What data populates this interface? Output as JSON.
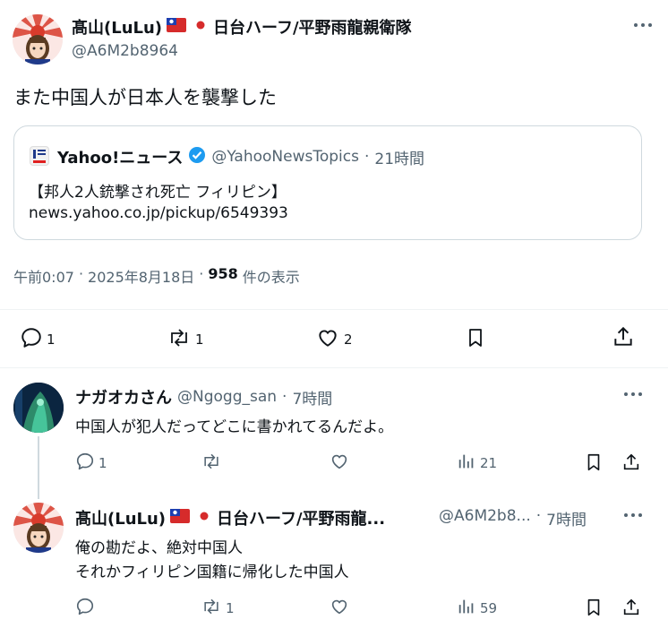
{
  "main_post": {
    "display_name": "髙山(LuLu)",
    "name_suffix": "日台ハーフ/平野雨龍親衛隊",
    "handle": "@A6M2b8964",
    "text": "また中国人が日本人を襲撃した",
    "quote": {
      "source_name": "Yahoo!ニュース",
      "handle": "@YahooNewsTopics",
      "separator": "·",
      "time": "21時間",
      "headline": "【邦人2人銃撃され死亡 フィリピン】",
      "link": "news.yahoo.co.jp/pickup/6549393"
    },
    "meta": {
      "time": "午前0:07",
      "sep1": "·",
      "date": "2025年8月18日",
      "sep2": "·",
      "views_count": "958",
      "views_label": "件の表示"
    },
    "actions": {
      "replies": "1",
      "reposts": "1",
      "likes": "2"
    }
  },
  "replies": [
    {
      "display_name": "ナガオカさん",
      "handle": "@Ngogg_san",
      "separator": "·",
      "time": "7時間",
      "lines": [
        "中国人が犯人だってどこに書かれてるんだよ。"
      ],
      "actions": {
        "replies": "1",
        "reposts": "",
        "likes": "",
        "views": "21"
      }
    },
    {
      "display_name": "髙山(LuLu)",
      "name_suffix": "日台ハーフ/平野雨龍...",
      "handle": "@A6M2b8...",
      "separator": "·",
      "time": "7時間",
      "lines": [
        "俺の勘だよ、絶対中国人",
        "それかフィリピン国籍に帰化した中国人"
      ],
      "actions": {
        "replies": "",
        "reposts": "1",
        "likes": "",
        "views": "59"
      }
    }
  ],
  "colors": {
    "text": "#0f1419",
    "muted": "#536471",
    "border": "#cfd9de",
    "verified": "#1d9bf0"
  },
  "icons": [
    "more-icon",
    "reply-icon",
    "repost-icon",
    "like-icon",
    "bookmark-icon",
    "share-icon",
    "views-icon",
    "verified-badge-icon",
    "taiwan-flag-icon",
    "japan-flag-icon"
  ]
}
